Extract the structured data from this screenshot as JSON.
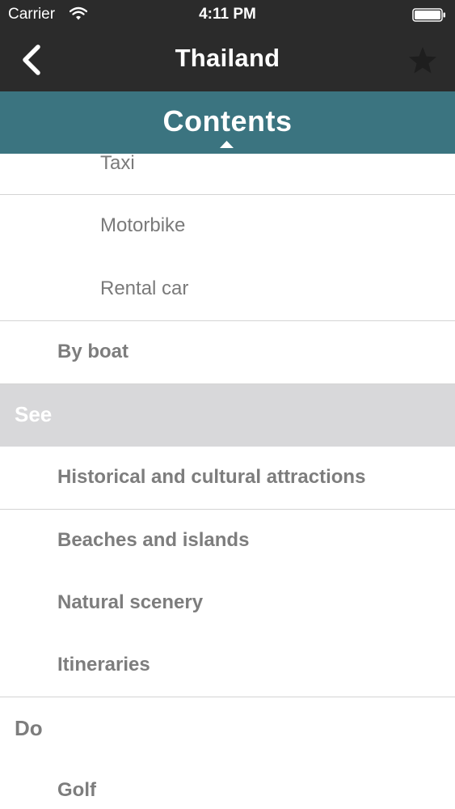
{
  "status_bar": {
    "carrier": "Carrier",
    "time": "4:11 PM"
  },
  "nav": {
    "title": "Thailand",
    "back_icon": "chevron-left-icon",
    "favorite_icon": "star-icon"
  },
  "contents_header": {
    "title": "Contents",
    "caret_icon": "caret-up-icon"
  },
  "toc": {
    "items": [
      {
        "label": "Taxi",
        "level": 3,
        "active": false
      },
      {
        "label": "Motorbike",
        "level": 3,
        "active": false
      },
      {
        "label": "Rental car",
        "level": 3,
        "active": false
      },
      {
        "label": "By boat",
        "level": 2,
        "active": false
      },
      {
        "label": "See",
        "level": 1,
        "active": true
      },
      {
        "label": "Historical and cultural attractions",
        "level": 2,
        "active": false
      },
      {
        "label": "Beaches and islands",
        "level": 2,
        "active": false
      },
      {
        "label": "Natural scenery",
        "level": 2,
        "active": false
      },
      {
        "label": "Itineraries",
        "level": 2,
        "active": false
      },
      {
        "label": "Do",
        "level": 1,
        "active": false
      },
      {
        "label": "Golf",
        "level": 2,
        "active": false
      }
    ]
  },
  "colors": {
    "bar_background": "#2b2b2b",
    "contents_background": "#3b7480",
    "active_row": "#d8d8da",
    "item_text": "#7a7a7a"
  }
}
